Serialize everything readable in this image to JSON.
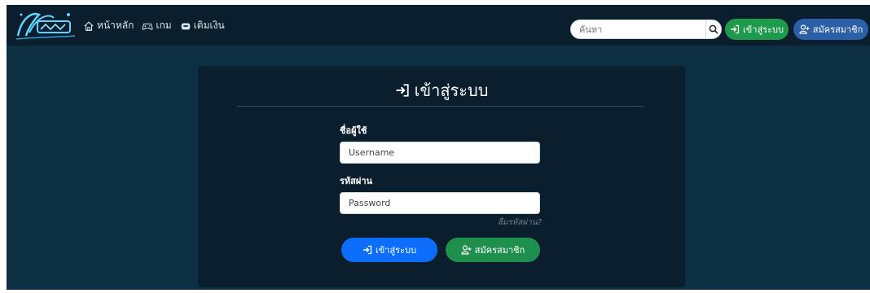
{
  "colors": {
    "page_bg": "#0d2f43",
    "navbar_bg": "#0b1e2e",
    "card_bg": "#0b1e2e",
    "login_top": "#1d9a4c",
    "register_top": "#2b5fa8",
    "login_main": "#0d6efd",
    "register_main": "#1f8f4e"
  },
  "navbar": {
    "logo_icon": "neon-logo",
    "links": [
      {
        "label": "หน้าหลัก",
        "icon": "home-icon"
      },
      {
        "label": "เกม",
        "icon": "gamepad-icon"
      },
      {
        "label": "เติมเงิน",
        "icon": "wallet-icon"
      }
    ],
    "search": {
      "placeholder": "ค้นหา",
      "icon": "search-icon"
    },
    "login_label": "เข้าสู่ระบบ",
    "register_label": "สมัครสมาชิก"
  },
  "login_form": {
    "title": "เข้าสู่ระบบ",
    "username_label": "ชื่อผู้ใช้",
    "username_placeholder": "Username",
    "password_label": "รหัสผ่าน",
    "password_placeholder": "Password",
    "forgot_label": "ลืมรหัสผ่าน?",
    "submit_label": "เข้าสู่ระบบ",
    "register_label": "สมัครสมาชิก"
  }
}
